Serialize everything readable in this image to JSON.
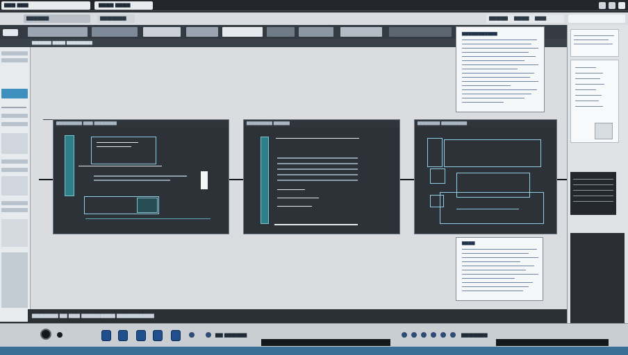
{
  "titlebar": {
    "left_title": "▆▆▆ ▆▆▆",
    "right_title": "▆▆▆▆ ▆▆▆▆",
    "window_buttons": [
      "minimize",
      "maximize",
      "close"
    ]
  },
  "menubar": {
    "items": [
      "▆▆▆▆▆▆",
      "▆▆▆▆▆▆▆",
      "▆▆▆▆▆",
      "▆▆▆"
    ],
    "right_items": [
      "▆▆▆▆▆",
      "▆▆▆▆",
      "▆▆▆"
    ]
  },
  "subbar": {
    "text": "▆▆▆▆▆▆ ▆▆▆▆ ▆▆▆▆▆▆▆▆"
  },
  "slides": [
    {
      "header": "▆▆▆▆▆▆▆▆ ▆▆▆ ▆▆▆▆▆▆▆"
    },
    {
      "header": "▆▆▆▆▆▆▆▆ ▆▆▆▆▆"
    },
    {
      "header": "▆▆▆▆▆▆▆ ▆▆▆▆▆▆▆▆"
    }
  ],
  "docs": [
    {
      "title": "▆▆▆▆▆▆▆▆▆▆▆"
    },
    {
      "title": "▆▆▆▆"
    }
  ],
  "bottomstrip": {
    "text": "▆▆▆▆▆▆▆ ▆▆ ▆▆▆ ▆▆▆▆▆▆▆▆▆ ▆▆▆▆▆▆▆▆▆▆"
  },
  "taskbar": {
    "center_text": "▆▆ ▆▆▆▆▆▆",
    "right_text": "▆▆▆▆▆▆▆"
  },
  "icons": [
    "search-icon",
    "document-icon",
    "folder-icon",
    "gear-icon",
    "image-icon"
  ],
  "colors": {
    "accent": "#3f8fbf",
    "slide_bg": "#2d3138",
    "cyan": "#8fd0e6"
  }
}
